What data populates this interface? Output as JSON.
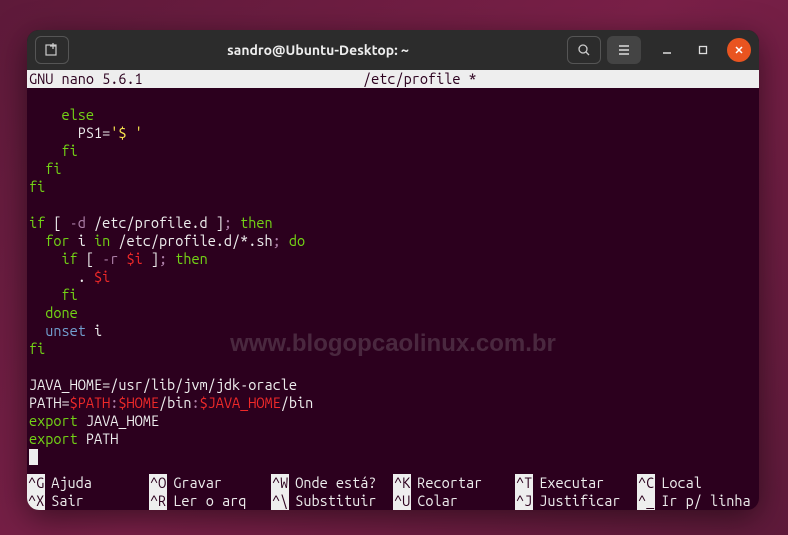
{
  "titlebar": {
    "title": "sandro@Ubuntu-Desktop: ~"
  },
  "nano": {
    "app": "GNU nano 5.6.1",
    "file": "/etc/profile *"
  },
  "code": {
    "l1_else": "else",
    "l2_ps1": "PS1",
    "l2_assign": "=",
    "l2_str": "'$ '",
    "l3_fi": "fi",
    "l4_fi": "fi",
    "l5_fi": "fi",
    "l7_if": "if",
    "l7_lb": " [ ",
    "l7_flag": "-d",
    "l7_path": " /etc/profile.d ",
    "l7_rb": "]",
    "l7_semi": "; ",
    "l7_then": "then",
    "l8_for": "for",
    "l8_i": " i ",
    "l8_in": "in",
    "l8_glob": " /etc/profile.d/*.sh",
    "l8_semi": "; ",
    "l8_do": "do",
    "l9_if": "if",
    "l9_lb": " [ ",
    "l9_flag": "-r",
    "l9_sp": " ",
    "l9_var": "$i",
    "l9_rb": " ]",
    "l9_semi": "; ",
    "l9_then": "then",
    "l10_dot": ". ",
    "l10_var": "$i",
    "l11_fi": "fi",
    "l12_done": "done",
    "l13_unset": "unset",
    "l13_i": " i",
    "l14_fi": "fi",
    "l16_jh": "JAVA_HOME",
    "l16_eq": "=",
    "l16_val": "/usr/lib/jvm/jdk-oracle",
    "l17_path": "PATH",
    "l17_eq": "=",
    "l17_v1": "$PATH",
    "l17_c1": ":",
    "l17_v2": "$HOME",
    "l17_t1": "/bin",
    "l17_c2": ":",
    "l17_v3": "$JAVA_HOME",
    "l17_t2": "/bin",
    "l18_export": "export",
    "l18_v": " JAVA_HOME",
    "l19_export": "export",
    "l19_v": " PATH"
  },
  "watermark": "www.blogopcaolinux.com.br",
  "shortcuts": {
    "row1": [
      {
        "key": "^G",
        "label": "Ajuda"
      },
      {
        "key": "^O",
        "label": "Gravar"
      },
      {
        "key": "^W",
        "label": "Onde está?"
      },
      {
        "key": "^K",
        "label": "Recortar"
      },
      {
        "key": "^T",
        "label": "Executar"
      },
      {
        "key": "^C",
        "label": "Local"
      }
    ],
    "row2": [
      {
        "key": "^X",
        "label": "Sair"
      },
      {
        "key": "^R",
        "label": "Ler o arq"
      },
      {
        "key": "^\\",
        "label": "Substituir"
      },
      {
        "key": "^U",
        "label": "Colar"
      },
      {
        "key": "^J",
        "label": "Justificar"
      },
      {
        "key": "^_",
        "label": "Ir p/ linha"
      }
    ]
  }
}
